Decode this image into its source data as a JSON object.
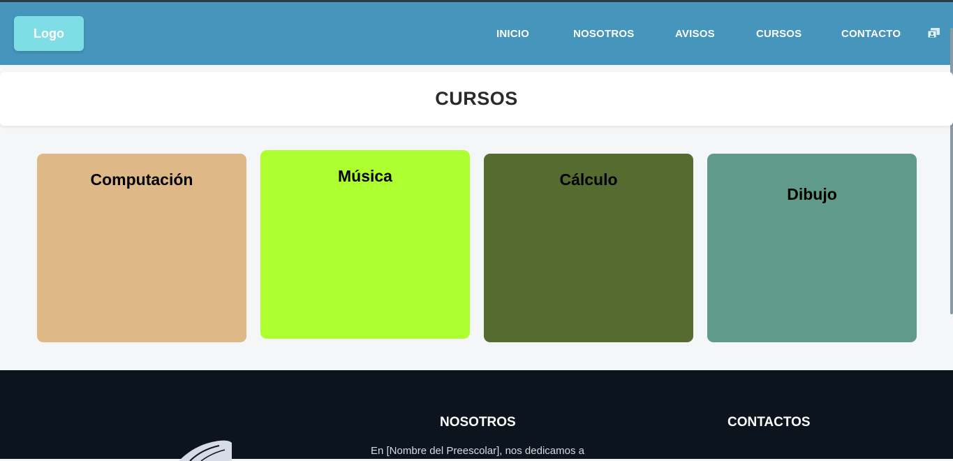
{
  "header": {
    "logo_label": "Logo",
    "nav": {
      "inicio": "INICIO",
      "nosotros": "NOSOTROS",
      "avisos": "AVISOS",
      "cursos": "CURSOS",
      "contacto": "CONTACTO"
    },
    "user_icon": "user-card-icon"
  },
  "page": {
    "title": "CURSOS"
  },
  "courses": [
    {
      "name": "Computación",
      "color": "#deb887"
    },
    {
      "name": "Música",
      "color": "#adff2f"
    },
    {
      "name": "Cálculo",
      "color": "#556b2f"
    },
    {
      "name": "Dibujo",
      "color": "#5f9b88"
    }
  ],
  "footer": {
    "nosotros_heading": "NOSOTROS",
    "nosotros_text": "En [Nombre del Preescolar], nos dedicamos a",
    "contactos_heading": "CONTACTOS",
    "logo_icon": "feather-logo-icon"
  },
  "colors": {
    "navbar": "#4695bc",
    "logo_button": "#7fdde6",
    "footer": "#0c141d"
  }
}
